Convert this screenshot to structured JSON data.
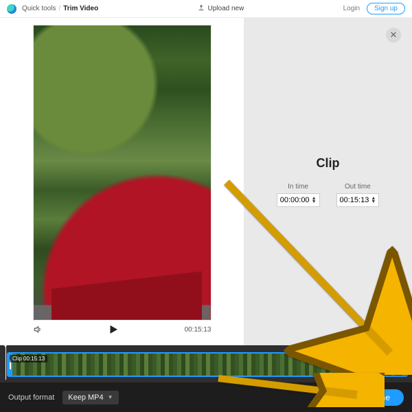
{
  "topbar": {
    "breadcrumb_root": "Quick tools",
    "breadcrumb_current": "Trim Video",
    "upload_label": "Upload new",
    "login_label": "Login",
    "signup_label": "Sign up"
  },
  "preview": {
    "duration_display": "00:15:13"
  },
  "side_panel": {
    "title": "Clip",
    "in_time_label": "In time",
    "out_time_label": "Out time",
    "in_time_value": "00:00:00",
    "out_time_value": "00:15:13"
  },
  "timeline": {
    "clip_badge": "Clip 00:15:13"
  },
  "bottombar": {
    "output_format_label": "Output format",
    "format_selected": "Keep MP4",
    "done_label": "Done"
  },
  "colors": {
    "accent": "#1e9cff",
    "arrow": "#f5b400"
  }
}
